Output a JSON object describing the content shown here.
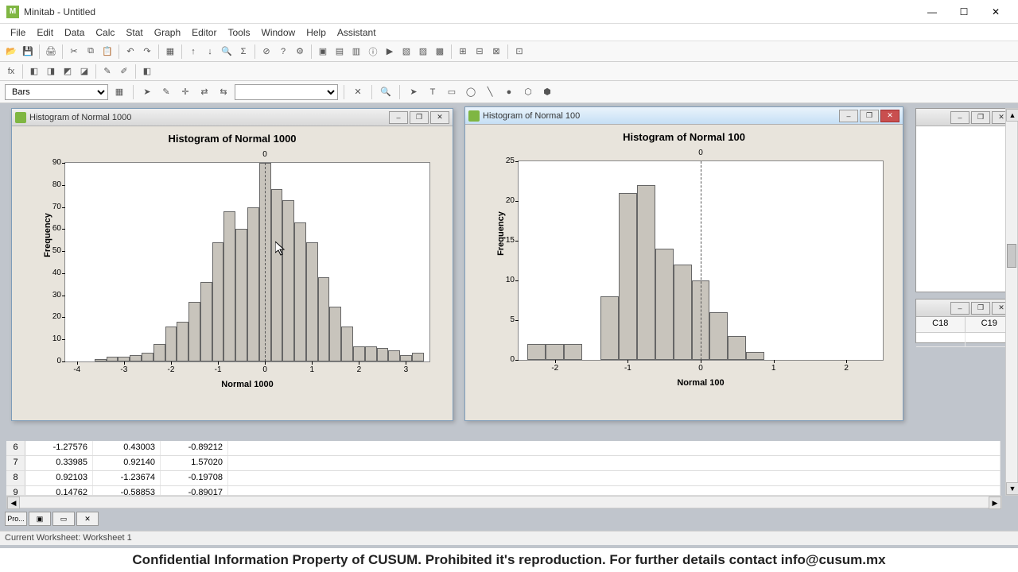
{
  "app": {
    "name": "Minitab",
    "doc": "Untitled"
  },
  "menu": [
    "File",
    "Edit",
    "Data",
    "Calc",
    "Stat",
    "Graph",
    "Editor",
    "Tools",
    "Window",
    "Help",
    "Assistant"
  ],
  "combo": {
    "bars": "Bars"
  },
  "chart_data": [
    {
      "type": "bar",
      "window_title": "Histogram of Normal 1000",
      "title": "Histogram of Normal 1000",
      "xlabel": "Normal 1000",
      "ylabel": "Frequency",
      "top_marker": "0",
      "ylim": [
        0,
        90
      ],
      "y_ticks": [
        0,
        10,
        20,
        30,
        40,
        50,
        60,
        70,
        80,
        90
      ],
      "x_ticks": [
        -4,
        -3,
        -2,
        -1,
        0,
        1,
        2,
        3
      ],
      "x_range": [
        -4.25,
        3.5
      ],
      "bin_width": 0.25,
      "categories": [
        -3.5,
        -3.25,
        -3.0,
        -2.75,
        -2.5,
        -2.25,
        -2.0,
        -1.75,
        -1.5,
        -1.25,
        -1.0,
        -0.75,
        -0.5,
        -0.25,
        0.0,
        0.25,
        0.5,
        0.75,
        1.0,
        1.25,
        1.5,
        1.75,
        2.0,
        2.25,
        2.5,
        2.75,
        3.0,
        3.25
      ],
      "values": [
        1,
        2,
        2,
        3,
        4,
        8,
        16,
        18,
        27,
        36,
        54,
        68,
        60,
        70,
        90,
        78,
        73,
        63,
        54,
        38,
        25,
        16,
        7,
        7,
        6,
        5,
        3,
        4
      ]
    },
    {
      "type": "bar",
      "window_title": "Histogram of Normal 100",
      "title": "Histogram of Normal 100",
      "xlabel": "Normal 100",
      "ylabel": "Frequency",
      "top_marker": "0",
      "ylim": [
        0,
        25
      ],
      "y_ticks": [
        0,
        5,
        10,
        15,
        20,
        25
      ],
      "x_ticks": [
        -2,
        -1,
        0,
        1,
        2
      ],
      "x_range": [
        -2.5,
        2.5
      ],
      "bin_width": 0.25,
      "categories": [
        -2.25,
        -2.0,
        -1.75,
        -1.25,
        -1.0,
        -0.75,
        -0.5,
        -0.25,
        0.0,
        0.25,
        0.5,
        0.75,
        1.0,
        1.25,
        1.5,
        1.75,
        2.0
      ],
      "values": [
        2,
        2,
        2,
        8,
        21,
        22,
        14,
        12,
        10,
        6,
        3,
        1,
        0,
        0,
        0,
        0,
        0
      ]
    }
  ],
  "chart100_alt": {
    "categories": [
      -2.25,
      -2.0,
      -1.75,
      -1.25,
      -1.0,
      -0.75,
      -0.5,
      -0.25,
      0.0,
      0.25,
      0.5,
      0.75,
      1.0,
      1.25,
      1.5
    ],
    "values": [
      2,
      2,
      2,
      8,
      21,
      22,
      14,
      12,
      10,
      6,
      3,
      1,
      0,
      0,
      0
    ]
  },
  "sheet_cols": [
    "C18",
    "C19"
  ],
  "data_rows": [
    {
      "n": 6,
      "c1": "-1.27576",
      "c2": "0.43003",
      "c3": "-0.89212"
    },
    {
      "n": 7,
      "c1": "0.33985",
      "c2": "0.92140",
      "c3": "1.57020"
    },
    {
      "n": 8,
      "c1": "0.92103",
      "c2": "-1.23674",
      "c3": "-0.19708"
    },
    {
      "n": 9,
      "c1": "0.14762",
      "c2": "-0.58853",
      "c3": "-0.89017"
    }
  ],
  "status": "Current Worksheet: Worksheet 1",
  "project_tab": "Pro...",
  "footer": "Confidential Information Property of CUSUM. Prohibited it's reproduction. For further details contact info@cusum.mx"
}
